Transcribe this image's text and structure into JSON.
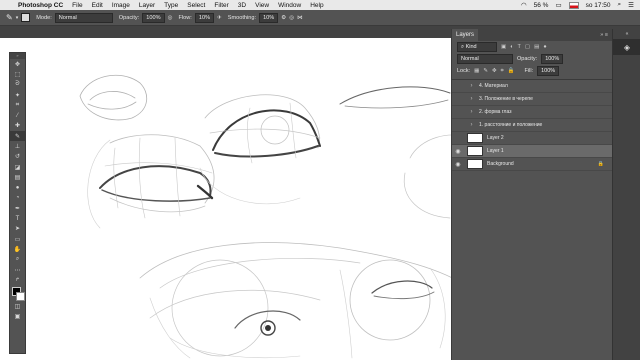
{
  "menubar": {
    "app_name": "Photoshop CC",
    "menus": [
      "File",
      "Edit",
      "Image",
      "Layer",
      "Type",
      "Select",
      "Filter",
      "3D",
      "View",
      "Window",
      "Help"
    ],
    "battery": "56 %",
    "flag": "CZE",
    "clock": "so 17:50"
  },
  "options": {
    "mode_label": "Mode:",
    "mode_value": "Normal",
    "opacity_label": "Opacity:",
    "opacity_value": "100%",
    "flow_label": "Flow:",
    "flow_value": "10%",
    "smoothing_label": "Smoothing:",
    "smoothing_value": "10%"
  },
  "layers_panel": {
    "tab": "Layers",
    "filter_label": "Kind",
    "blend_mode": "Normal",
    "opacity_label": "Opacity:",
    "opacity_value": "100%",
    "lock_label": "Lock:",
    "fill_label": "Fill:",
    "fill_value": "100%",
    "items": [
      {
        "name": "4. Материал"
      },
      {
        "name": "3. Положение в черепе"
      },
      {
        "name": "2. форма глаз"
      },
      {
        "name": "1. расстояние и положение"
      },
      {
        "name": "Layer 2"
      },
      {
        "name": "Layer 1"
      },
      {
        "name": "Background"
      }
    ]
  },
  "icons": {
    "apple": "apple-icon",
    "brush": "brush-tool-icon",
    "eye": "visibility-eye-icon",
    "lock": "lock-icon",
    "folder": "group-folder-icon"
  },
  "colors": {
    "panel": "#535353",
    "panel_dark": "#424242",
    "selected_layer": "#6a6a6a"
  }
}
